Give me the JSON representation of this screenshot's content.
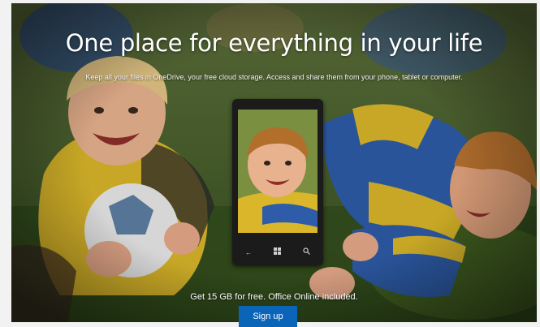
{
  "hero": {
    "title": "One place for everything in your life",
    "subtitle": "Keep all your files in OneDrive, your free cloud storage. Access and share them from your phone, tablet or computer.",
    "offer": "Get 15 GB for free. Office Online included.",
    "signup_label": "Sign up"
  },
  "colors": {
    "accent": "#0a64b8",
    "grass": "#3d5a2a",
    "jersey_yellow": "#d9b62a",
    "jersey_blue": "#2e5ca8"
  },
  "icons": {
    "phone_back": "back-arrow-icon",
    "phone_start": "windows-logo-icon",
    "phone_search": "search-icon"
  }
}
